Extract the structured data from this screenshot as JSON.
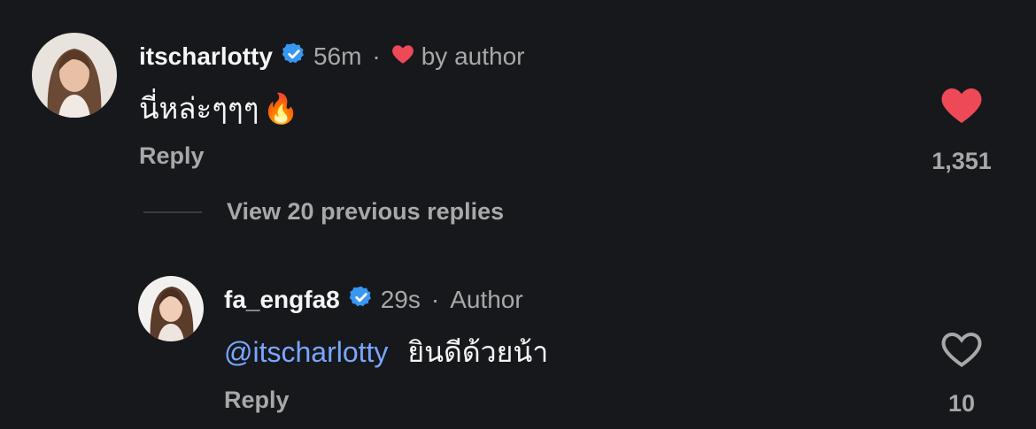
{
  "comments": [
    {
      "username": "itscharlotty",
      "time": "56m",
      "liked_by_author_label": "by author",
      "text": "นี่หล่ะๆๆๆ",
      "emoji": "🔥",
      "reply_label": "Reply",
      "like_count": "1,351",
      "liked": true,
      "avatar_icon": "avatar-photo"
    },
    {
      "username": "fa_engfa8",
      "time": "29s",
      "role": "Author",
      "mention": "@itscharlotty",
      "text": "ยินดีด้วยน้า",
      "reply_label": "Reply",
      "like_count": "10",
      "liked": false,
      "avatar_icon": "avatar-photo"
    }
  ],
  "view_replies": {
    "label": "View 20 previous replies"
  },
  "colors": {
    "background": "#16181c",
    "verified": "#3897f0",
    "heart": "#ed4956",
    "mention": "#7aa6ff",
    "muted": "#a8a8a8"
  }
}
